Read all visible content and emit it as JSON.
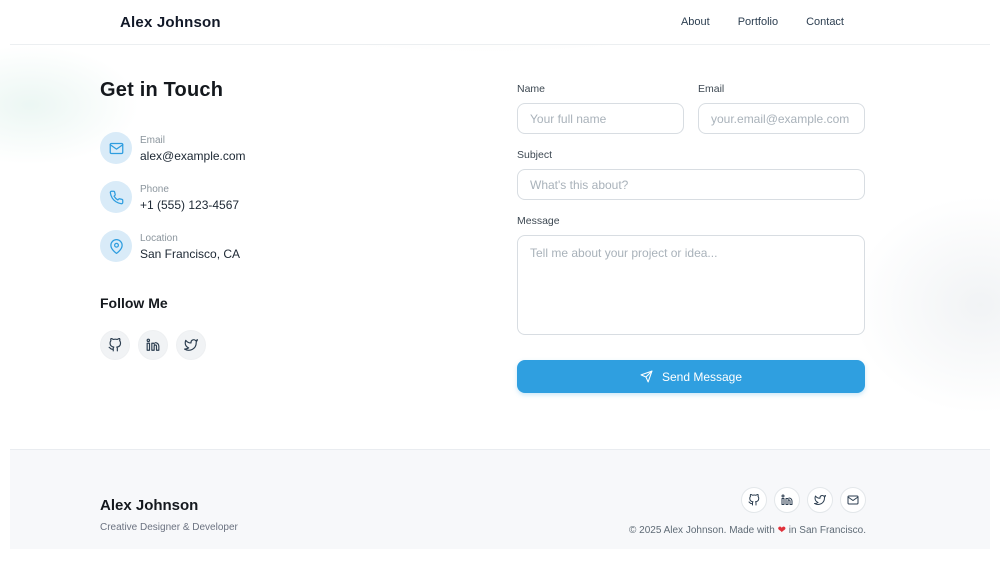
{
  "header": {
    "brand": "Alex Johnson",
    "nav": [
      {
        "label": "About"
      },
      {
        "label": "Portfolio"
      },
      {
        "label": "Contact"
      }
    ]
  },
  "contact": {
    "title": "Get in Touch",
    "items": [
      {
        "icon": "mail-icon",
        "label": "Email",
        "value": "alex@example.com"
      },
      {
        "icon": "phone-icon",
        "label": "Phone",
        "value": "+1 (555) 123-4567"
      },
      {
        "icon": "map-pin-icon",
        "label": "Location",
        "value": "San Francisco, CA"
      }
    ],
    "follow_title": "Follow Me",
    "social": [
      {
        "icon": "github-icon"
      },
      {
        "icon": "linkedin-icon"
      },
      {
        "icon": "twitter-icon"
      }
    ]
  },
  "form": {
    "fields": [
      {
        "label": "Name",
        "placeholder": "Your full name"
      },
      {
        "label": "Email",
        "placeholder": "your.email@example.com"
      },
      {
        "label": "Subject",
        "placeholder": "What's this about?"
      },
      {
        "label": "Message",
        "placeholder": "Tell me about your project or idea..."
      }
    ],
    "submit_label": "Send Message",
    "submit_icon": "send-icon"
  },
  "footer": {
    "brand": "Alex Johnson",
    "tagline": "Creative Designer & Developer",
    "social": [
      {
        "icon": "github-icon"
      },
      {
        "icon": "linkedin-icon"
      },
      {
        "icon": "twitter-icon"
      },
      {
        "icon": "mail-icon"
      }
    ],
    "copyright_prefix": "© 2025 Alex Johnson. Made with",
    "heart": "❤",
    "copyright_suffix": "in San Francisco."
  },
  "colors": {
    "accent": "#2f9fe0",
    "accent_soft": "#d9ebf8",
    "footer_bg": "#f7f8fa",
    "heart": "#e0313b"
  }
}
